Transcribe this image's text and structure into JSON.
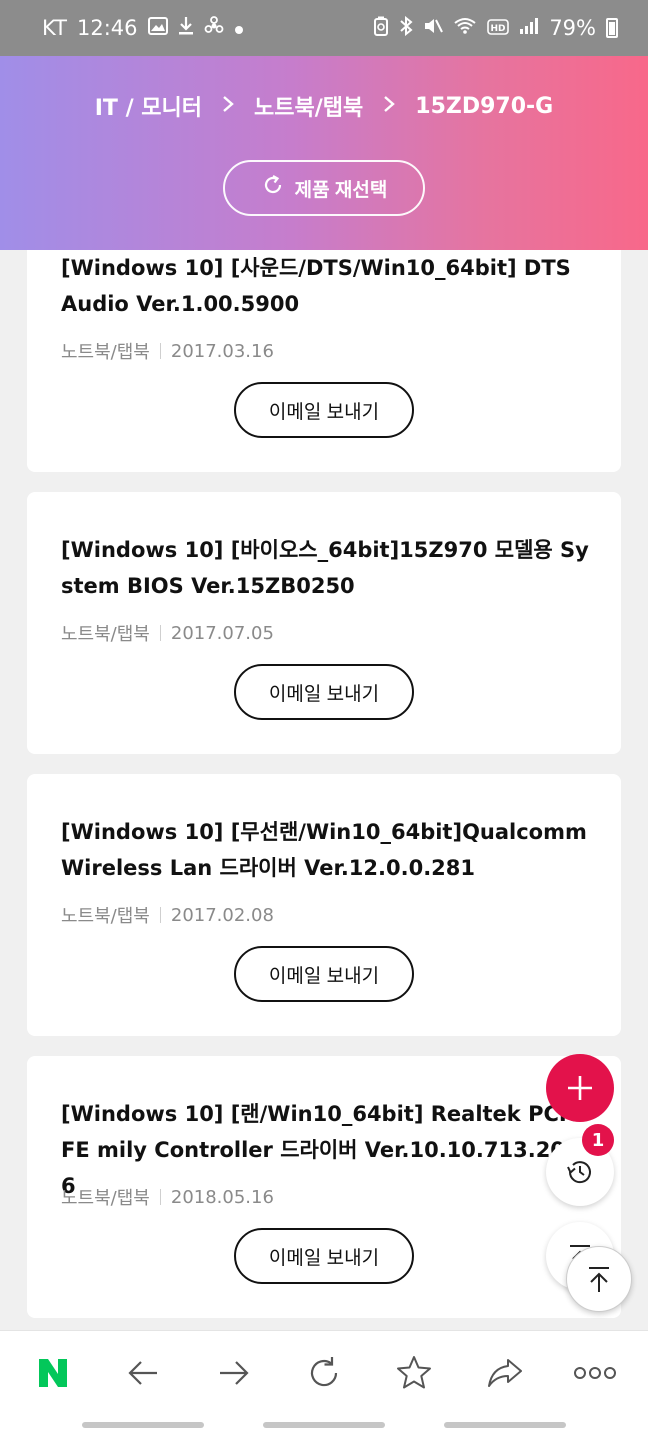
{
  "status_bar": {
    "carrier": "KT",
    "time": "12:46",
    "battery": "79%"
  },
  "header": {
    "breadcrumb": [
      "IT / 모니터",
      "노트북/탭북",
      "15ZD970-G"
    ],
    "separator": ">",
    "reselect_label": "제품 재선택"
  },
  "items": [
    {
      "title": "[Windows 10] [사운드/DTS/Win10_64bit] DTS Audio Ver.1.00.5900",
      "category": "노트북/탭북",
      "date": "2017.03.16",
      "email_label": "이메일 보내기"
    },
    {
      "title": "[Windows 10] [바이오스_64bit]15Z970 모델용 System BIOS Ver.15ZB0250",
      "category": "노트북/탭북",
      "date": "2017.07.05",
      "email_label": "이메일 보내기"
    },
    {
      "title": "[Windows 10] [무선랜/Win10_64bit]Qualcomm Wireless Lan 드라이버 Ver.12.0.0.281",
      "category": "노트북/탭북",
      "date": "2017.02.08",
      "email_label": "이메일 보내기"
    },
    {
      "title": "[Windows 10] [랜/Win10_64bit] Realtek PCIe FE mily Controller 드라이버 Ver.10.10.713.2016",
      "category": "노트북/탭북",
      "date": "2018.05.16",
      "email_label": "이메일 보내기"
    }
  ],
  "floating": {
    "history_count": "1"
  },
  "browser_bar": {
    "logo": "N"
  },
  "colors": {
    "accent": "#e3124b",
    "header_gradient_start": "#a08ee8",
    "header_gradient_end": "#f8688a",
    "naver_green": "#03c75a"
  }
}
